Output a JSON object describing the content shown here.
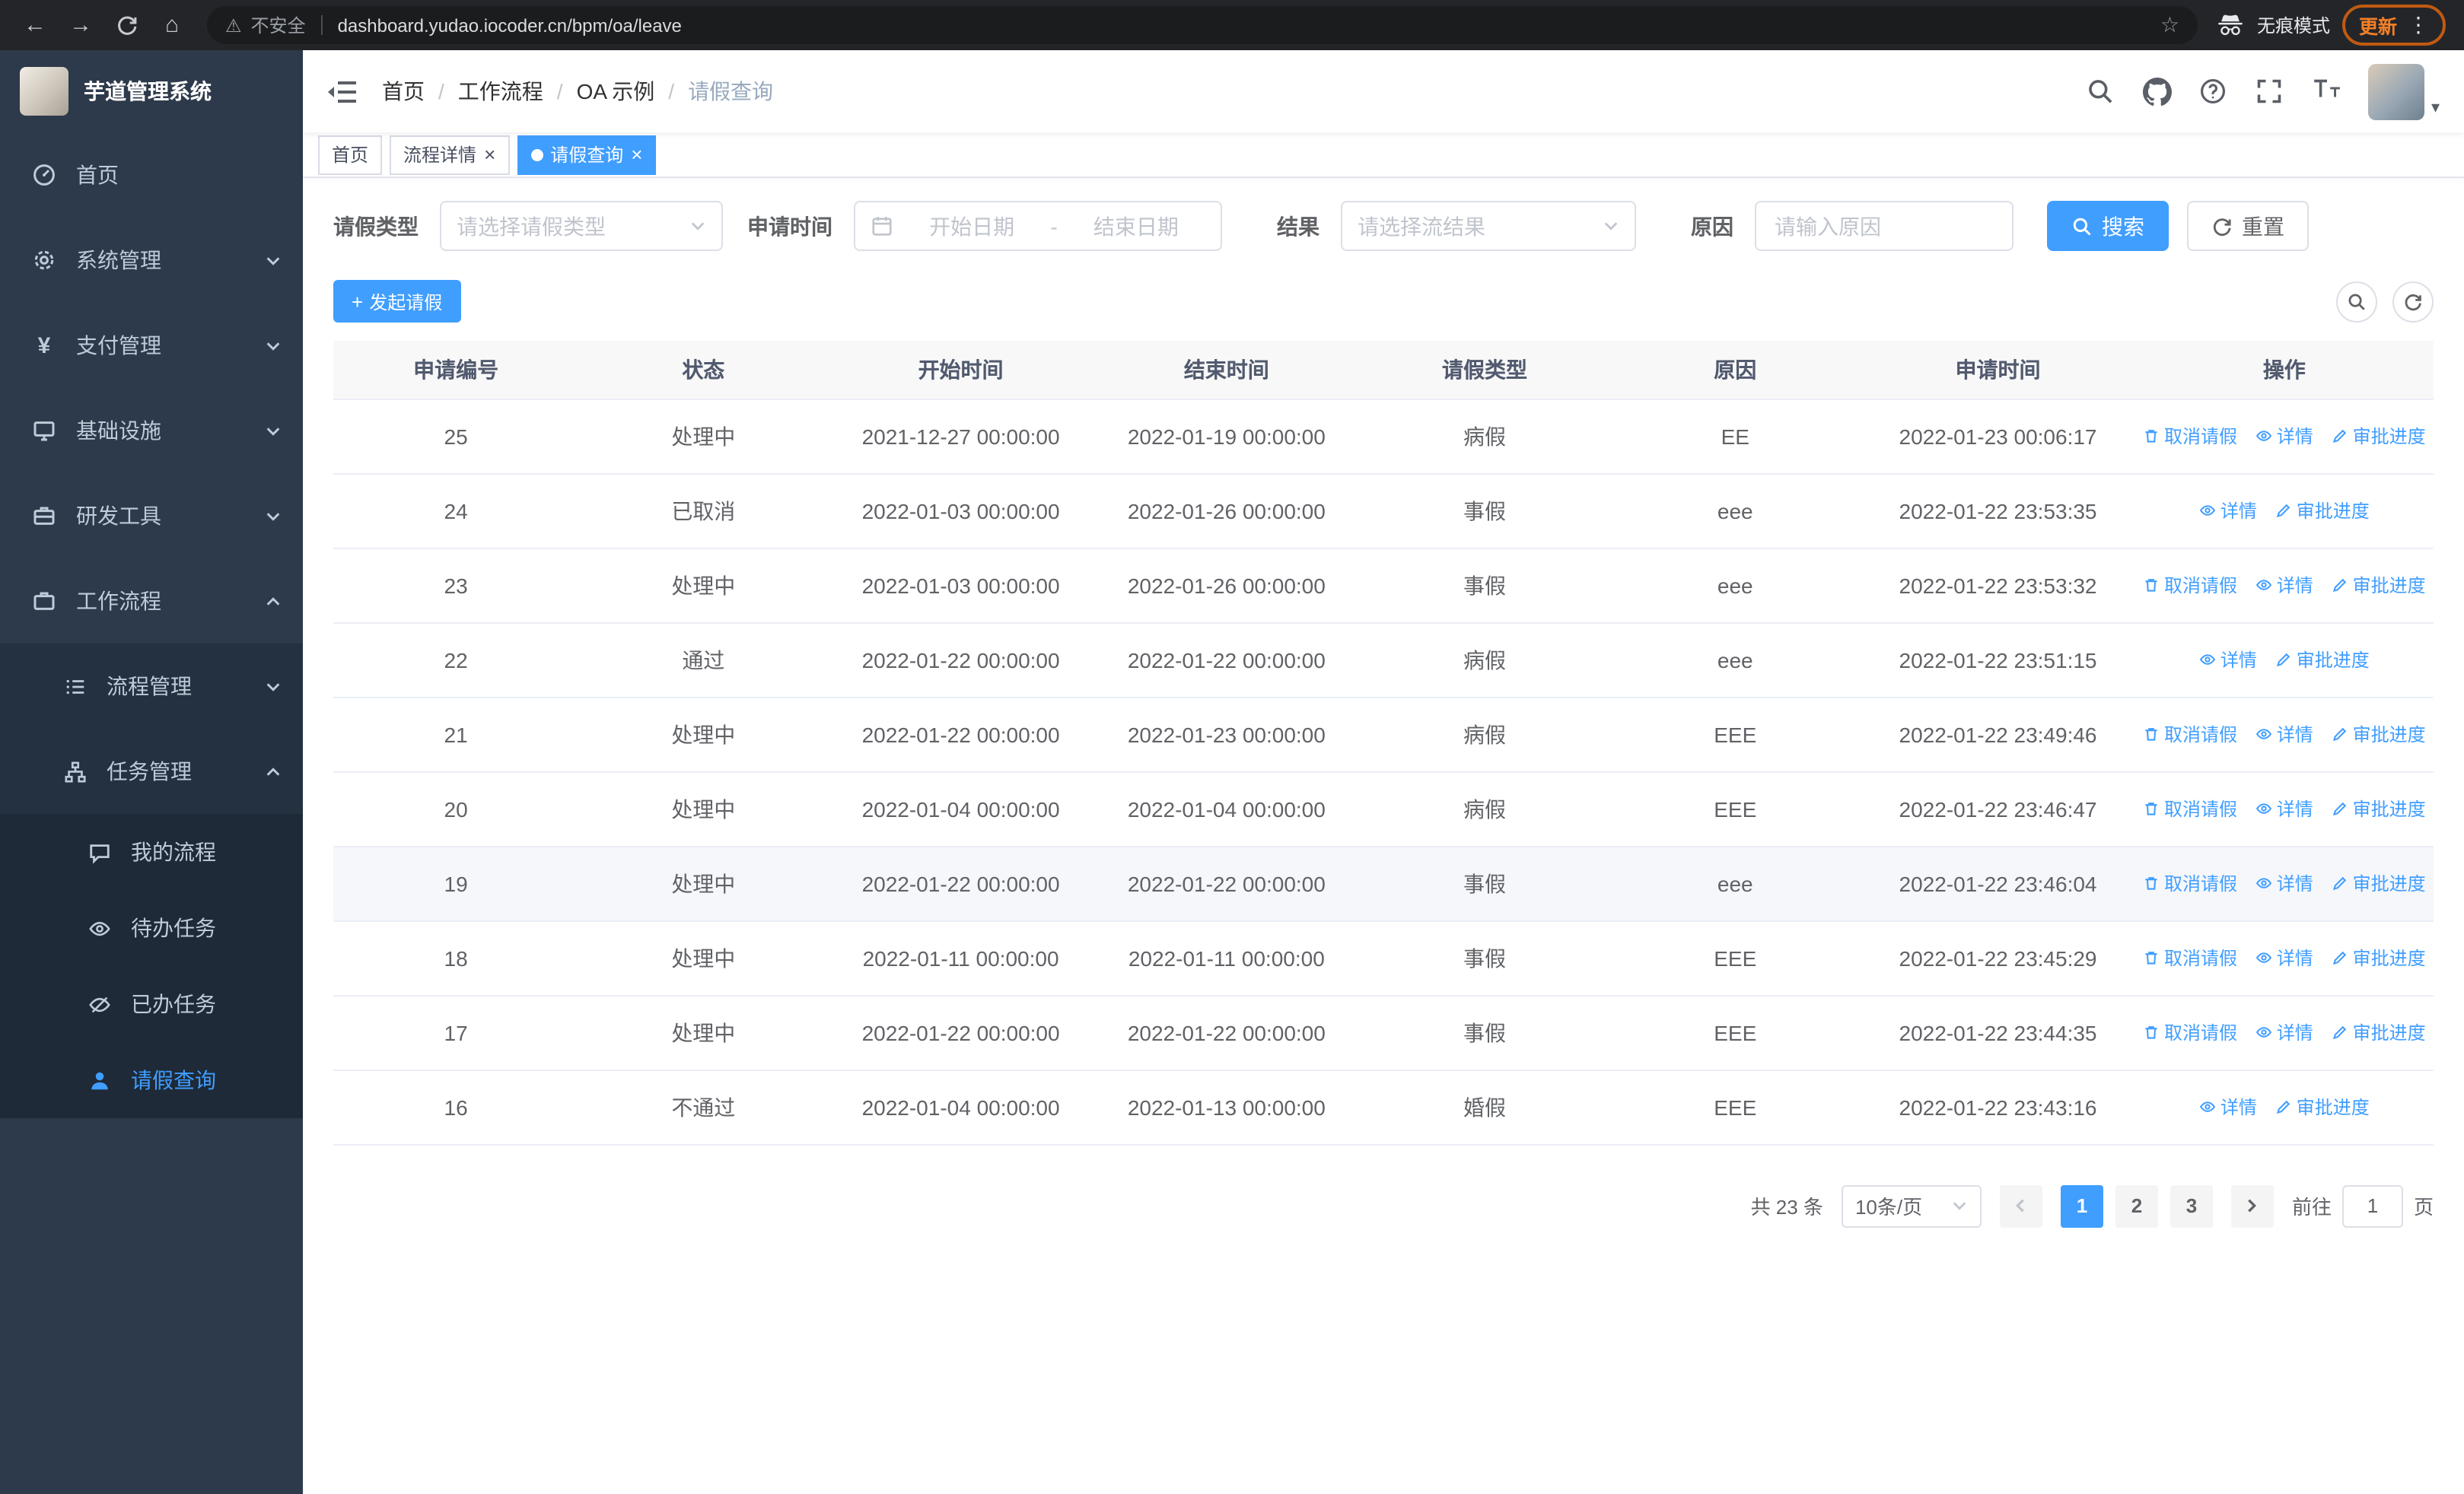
{
  "browser": {
    "security_label": "不安全",
    "url": "dashboard.yudao.iocoder.cn/bpm/oa/leave",
    "incognito_label": "无痕模式",
    "update_label": "更新"
  },
  "icons": {
    "back": "←",
    "forward": "→",
    "home": "⌂",
    "warning": "⚠",
    "star": "☆",
    "menu_dots": "⋮",
    "close": "×",
    "yen": "¥",
    "plus": "+",
    "caret_down": "▾"
  },
  "sidebar": {
    "logo_title": "芋道管理系统",
    "menu": [
      {
        "label": "首页"
      },
      {
        "label": "系统管理"
      },
      {
        "label": "支付管理"
      },
      {
        "label": "基础设施"
      },
      {
        "label": "研发工具"
      },
      {
        "label": "工作流程"
      }
    ],
    "workflow_children": [
      {
        "label": "流程管理"
      },
      {
        "label": "任务管理"
      }
    ],
    "task_children": [
      {
        "label": "我的流程"
      },
      {
        "label": "待办任务"
      },
      {
        "label": "已办任务"
      },
      {
        "label": "请假查询"
      }
    ]
  },
  "navbar": {
    "breadcrumb": [
      "首页",
      "工作流程",
      "OA 示例",
      "请假查询"
    ],
    "separator": "/"
  },
  "tabs": [
    {
      "label": "首页",
      "closable": false,
      "active": false
    },
    {
      "label": "流程详情",
      "closable": true,
      "active": false
    },
    {
      "label": "请假查询",
      "closable": true,
      "active": true
    }
  ],
  "filters": {
    "leave_type_label": "请假类型",
    "leave_type_placeholder": "请选择请假类型",
    "apply_time_label": "申请时间",
    "start_placeholder": "开始日期",
    "range_separator": "-",
    "end_placeholder": "结束日期",
    "result_label": "结果",
    "result_placeholder": "请选择流结果",
    "reason_label": "原因",
    "reason_placeholder": "请输入原因",
    "search_label": "搜索",
    "reset_label": "重置"
  },
  "toolbar": {
    "create_label": "发起请假"
  },
  "table": {
    "headers": [
      "申请编号",
      "状态",
      "开始时间",
      "结束时间",
      "请假类型",
      "原因",
      "申请时间",
      "操作"
    ],
    "action_labels": {
      "cancel": "取消请假",
      "detail": "详情",
      "progress": "审批进度"
    },
    "rows": [
      {
        "id": "25",
        "status": "处理中",
        "start": "2021-12-27 00:00:00",
        "end": "2022-01-19 00:00:00",
        "type": "病假",
        "reason": "EE",
        "applied": "2022-01-23 00:06:17",
        "can_cancel": true,
        "highlight": false
      },
      {
        "id": "24",
        "status": "已取消",
        "start": "2022-01-03 00:00:00",
        "end": "2022-01-26 00:00:00",
        "type": "事假",
        "reason": "eee",
        "applied": "2022-01-22 23:53:35",
        "can_cancel": false,
        "highlight": false
      },
      {
        "id": "23",
        "status": "处理中",
        "start": "2022-01-03 00:00:00",
        "end": "2022-01-26 00:00:00",
        "type": "事假",
        "reason": "eee",
        "applied": "2022-01-22 23:53:32",
        "can_cancel": true,
        "highlight": false
      },
      {
        "id": "22",
        "status": "通过",
        "start": "2022-01-22 00:00:00",
        "end": "2022-01-22 00:00:00",
        "type": "病假",
        "reason": "eee",
        "applied": "2022-01-22 23:51:15",
        "can_cancel": false,
        "highlight": false
      },
      {
        "id": "21",
        "status": "处理中",
        "start": "2022-01-22 00:00:00",
        "end": "2022-01-23 00:00:00",
        "type": "病假",
        "reason": "EEE",
        "applied": "2022-01-22 23:49:46",
        "can_cancel": true,
        "highlight": false
      },
      {
        "id": "20",
        "status": "处理中",
        "start": "2022-01-04 00:00:00",
        "end": "2022-01-04 00:00:00",
        "type": "病假",
        "reason": "EEE",
        "applied": "2022-01-22 23:46:47",
        "can_cancel": true,
        "highlight": false
      },
      {
        "id": "19",
        "status": "处理中",
        "start": "2022-01-22 00:00:00",
        "end": "2022-01-22 00:00:00",
        "type": "事假",
        "reason": "eee",
        "applied": "2022-01-22 23:46:04",
        "can_cancel": true,
        "highlight": true
      },
      {
        "id": "18",
        "status": "处理中",
        "start": "2022-01-11 00:00:00",
        "end": "2022-01-11 00:00:00",
        "type": "事假",
        "reason": "EEE",
        "applied": "2022-01-22 23:45:29",
        "can_cancel": true,
        "highlight": false
      },
      {
        "id": "17",
        "status": "处理中",
        "start": "2022-01-22 00:00:00",
        "end": "2022-01-22 00:00:00",
        "type": "事假",
        "reason": "EEE",
        "applied": "2022-01-22 23:44:35",
        "can_cancel": true,
        "highlight": false
      },
      {
        "id": "16",
        "status": "不通过",
        "start": "2022-01-04 00:00:00",
        "end": "2022-01-13 00:00:00",
        "type": "婚假",
        "reason": "EEE",
        "applied": "2022-01-22 23:43:16",
        "can_cancel": false,
        "highlight": false
      }
    ]
  },
  "pagination": {
    "total_label": "共 23 条",
    "page_size_label": "10条/页",
    "pages": [
      {
        "label": "1",
        "active": true
      },
      {
        "label": "2",
        "active": false
      },
      {
        "label": "3",
        "active": false
      }
    ],
    "goto_prefix": "前往",
    "goto_value": "1",
    "goto_suffix": "页"
  }
}
